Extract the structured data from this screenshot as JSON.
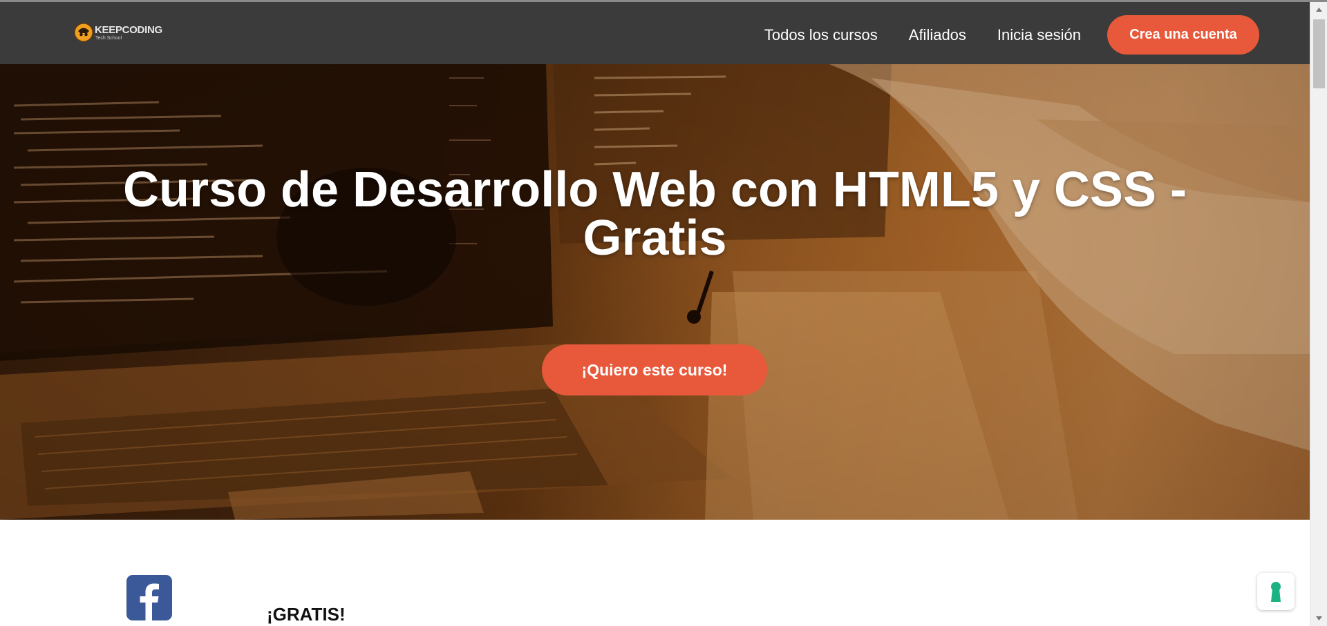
{
  "brand": {
    "name": "KEEPCODING",
    "tagline": "Tech School"
  },
  "nav": {
    "items": [
      {
        "label": "Todos los cursos"
      },
      {
        "label": "Afiliados"
      },
      {
        "label": "Inicia sesión"
      }
    ],
    "cta_label": "Crea una cuenta"
  },
  "hero": {
    "title_line1": "Curso de Desarrollo Web con HTML5 y CSS -",
    "title_line2": "Gratis",
    "cta_label": "¡Quiero este curso!"
  },
  "section": {
    "heading": "¡GRATIS!"
  },
  "colors": {
    "navbar": "#3b3b3b",
    "accent": "#e8593b",
    "hero_tint": "#b86f2c",
    "facebook": "#3b5998",
    "lock_icon": "#1bb385"
  },
  "icons": {
    "logo": "keepcoding-logo-icon",
    "social": "facebook-icon",
    "widget": "keyhole-lock-icon"
  }
}
